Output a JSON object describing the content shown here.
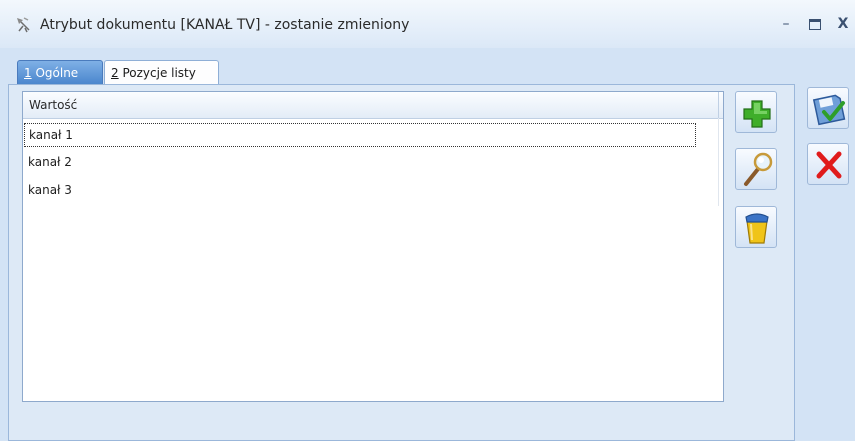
{
  "window": {
    "title": "Atrybut dokumentu [KANAŁ TV] - zostanie zmieniony",
    "app_icon": "app-icon",
    "controls": {
      "minimize": "–",
      "close": "X"
    }
  },
  "tabs": [
    {
      "number": "1",
      "label": " Ogólne",
      "active": false
    },
    {
      "number": "2",
      "label": " Pozycje listy",
      "active": true
    }
  ],
  "list": {
    "column_header": "Wartość",
    "rows": [
      "kanał 1",
      "kanał 2",
      "kanał 3"
    ],
    "selected_index": 0
  },
  "side_buttons": [
    "plus-icon",
    "magnifier-icon",
    "trash-bin-icon"
  ],
  "action_buttons": [
    "save-icon",
    "cancel-icon"
  ],
  "colors": {
    "window_background": "#d3e3f5",
    "add_green": "#3fae2a",
    "cancel_red": "#e01b1b",
    "trash_yellow": "#f0c419"
  }
}
